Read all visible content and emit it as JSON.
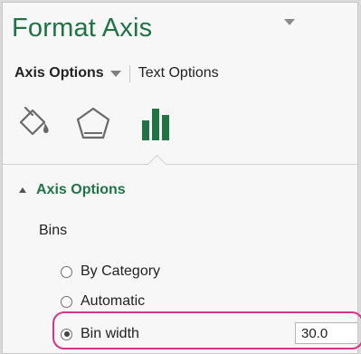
{
  "pane": {
    "title": "Format Axis"
  },
  "tabs": {
    "axis_options": "Axis Options",
    "text_options": "Text Options"
  },
  "icons": {
    "fill_line": "paint-bucket-icon",
    "effects": "pentagon-effects-icon",
    "axis_options": "bar-chart-icon"
  },
  "section": {
    "label": "Axis Options",
    "bins_label": "Bins"
  },
  "radios": {
    "by_category": "By Category",
    "automatic": "Automatic",
    "bin_width": "Bin width",
    "selected": "Bin width"
  },
  "bin_width_value": "30.0",
  "colors": {
    "accent_green": "#217346",
    "highlight_pink": "#d6338a"
  }
}
